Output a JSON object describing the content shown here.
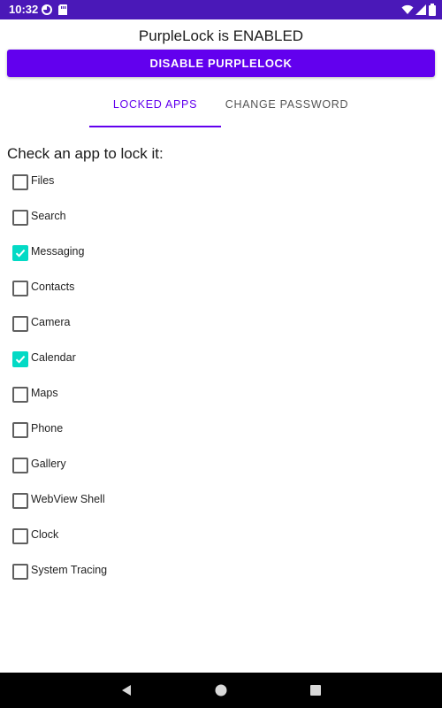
{
  "status_bar": {
    "time": "10:32",
    "color": "#4a18b8",
    "left_icons": [
      "circle-status-icon",
      "sd-card-icon"
    ],
    "right_icons": [
      "wifi-icon",
      "signal-icon",
      "battery-icon"
    ]
  },
  "app": {
    "title": "PurpleLock is ENABLED",
    "disable_button_label": "DISABLE PURPLELOCK",
    "accent_color": "#6200ee",
    "checkbox_checked_color": "#03dac5"
  },
  "tabs": [
    {
      "label": "LOCKED APPS",
      "selected": true
    },
    {
      "label": "CHANGE PASSWORD",
      "selected": false
    }
  ],
  "locked_apps": {
    "prompt": "Check an app to lock it:",
    "items": [
      {
        "label": "Files",
        "checked": false
      },
      {
        "label": "Search",
        "checked": false
      },
      {
        "label": "Messaging",
        "checked": true
      },
      {
        "label": "Contacts",
        "checked": false
      },
      {
        "label": "Camera",
        "checked": false
      },
      {
        "label": "Calendar",
        "checked": true
      },
      {
        "label": "Maps",
        "checked": false
      },
      {
        "label": "Phone",
        "checked": false
      },
      {
        "label": "Gallery",
        "checked": false
      },
      {
        "label": "WebView Shell",
        "checked": false
      },
      {
        "label": "Clock",
        "checked": false
      },
      {
        "label": "System Tracing",
        "checked": false
      }
    ]
  },
  "nav_bar": {
    "buttons": [
      "back-icon",
      "home-icon",
      "recents-icon"
    ]
  }
}
